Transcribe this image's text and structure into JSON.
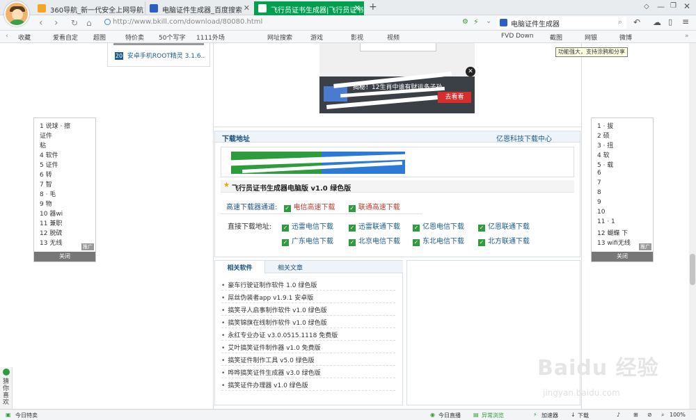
{
  "browser": {
    "tabs": [
      {
        "label": "360导航_新一代安全上网导航",
        "color": "#f4a522",
        "active": false
      },
      {
        "label": "电脑证件生成器_百度搜索",
        "color": "#2b5fc4",
        "active": false
      },
      {
        "label": "飞行员证书生成器|飞行员证书生",
        "color": "#1a9d46",
        "active": true
      }
    ],
    "url": "http://www.bkill.com/download/80080.html",
    "search_text": "电脑证件生成器",
    "bookmarks": [
      "收藏",
      "爱看自定",
      "超图",
      "特价卖",
      "50个写字",
      "1111外场",
      "网址搜索",
      "游戏",
      "影视",
      "视频",
      "FVD Down",
      "截图",
      "网银",
      "微博"
    ],
    "tooltip": "功能强大，支持涂鸦和分享",
    "status": {
      "left": "今日特卖",
      "items": [
        "今日直播",
        "异常浏览",
        "加速器",
        "下载",
        "100%"
      ]
    }
  },
  "page": {
    "top_list": [
      {
        "num": "20",
        "text": "安卓手机ROOT精灵 3.1.6.."
      }
    ],
    "ad": {
      "text": "揭秘！12生肖中谁有财运多子孙",
      "button": "去看看"
    },
    "download": {
      "section_title": "下载地址",
      "section_right": "亿恩科技下载中心",
      "product_title": "飞行员证书生成器电脑版 v1.0 绿色版",
      "high_speed_label": "高速下载器通道:",
      "high_speed_links": [
        "电信高速下载",
        "联通高速下载"
      ],
      "direct_label": "直接下载地址:",
      "direct_links": [
        "迅雷电信下载",
        "迅雷联通下载",
        "亿恩电信下载",
        "亿恩联通下载",
        "广东电信下载",
        "北京电信下载",
        "东北电信下载",
        "北方联通下载"
      ]
    },
    "related": {
      "tabs": [
        "相关软件",
        "相关文章"
      ],
      "items": [
        "豪车行驶证制作软件 1.0 绿色版",
        "屌丝伪装者app v1.9.1 安卓版",
        "搞笑寻人启事制作软件 v1.0 绿色版",
        "搞笑锦旗在线制作软件 v1.0 绿色版",
        "永红专业办证 v3.0.0515.1118 免费版",
        "艾叶搞笑证件制作器 v1.0 免费版",
        "搞笑证件制作工具 v5.0 绿色版",
        "哗哗搞笑证件生成器 v3.0 绿色版",
        "搞笑证件办理器 v1.0 绿色版"
      ]
    },
    "left_ad": {
      "rows": [
        "1 说球 · 擦",
        "证件",
        "粘",
        "4 软件",
        "5 证件",
        "6 转",
        "7 智",
        "8 · 毛",
        "9 物",
        "10 器wi",
        "11 兼职",
        "12 脱硫",
        "13 无线"
      ],
      "close": "关闭",
      "flag": "推广"
    },
    "right_ad": {
      "rows": [
        "1 · 拔",
        "2 硕",
        "3 · 扭",
        "4 软",
        "5 · 载",
        "6",
        "7",
        "8",
        "9",
        "10",
        "11 · 1",
        "12 蝴蝶 下",
        "13 wifi无线"
      ],
      "close": "关闭",
      "flag": "推广"
    },
    "side_widget": "猜你喜欢"
  },
  "watermark": {
    "brand": "Baidu 经验",
    "url": "jingyan.baidu.com"
  }
}
